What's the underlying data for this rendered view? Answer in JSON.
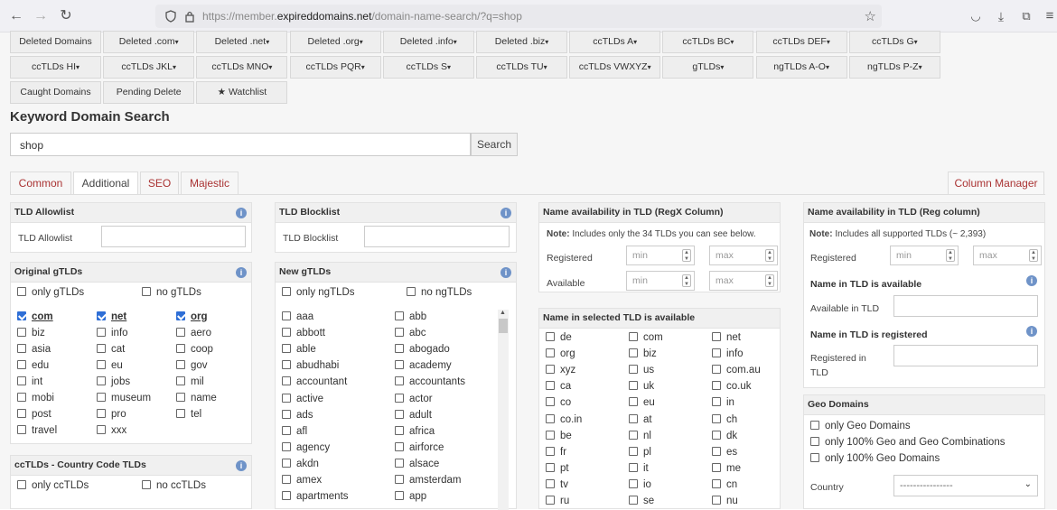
{
  "browser": {
    "url_prefix": "https://member.",
    "url_host": "expireddomains.net",
    "url_path": "/domain-name-search/?q=shop"
  },
  "nav": {
    "row1": [
      "Deleted Domains",
      "Deleted .com",
      "Deleted .net",
      "Deleted .org",
      "Deleted .info",
      "Deleted .biz",
      "ccTLDs A",
      "ccTLDs BC",
      "ccTLDs DEF",
      "ccTLDs G"
    ],
    "row2": [
      "ccTLDs HI",
      "ccTLDs JKL",
      "ccTLDs MNO",
      "ccTLDs PQR",
      "ccTLDs S",
      "ccTLDs TU",
      "ccTLDs VWXYZ",
      "gTLDs",
      "ngTLDs A-O",
      "ngTLDs P-Z"
    ],
    "row3": [
      "Caught Domains",
      "Pending Delete",
      "★ Watchlist"
    ]
  },
  "heading": "Keyword Domain Search",
  "search": {
    "value": "shop",
    "button": "Search"
  },
  "filter_tabs": [
    "Common",
    "Additional",
    "SEO",
    "Majestic"
  ],
  "column_manager": "Column Manager",
  "tld_allowlist": {
    "title": "TLD Allowlist",
    "label": "TLD Allowlist"
  },
  "tld_blocklist": {
    "title": "TLD Blocklist",
    "label": "TLD Blocklist"
  },
  "original_gtlds": {
    "title": "Original gTLDs",
    "only": "only gTLDs",
    "none": "no gTLDs",
    "items": [
      [
        "com",
        "net",
        "org"
      ],
      [
        "biz",
        "info",
        "aero"
      ],
      [
        "asia",
        "cat",
        "coop"
      ],
      [
        "edu",
        "eu",
        "gov"
      ],
      [
        "int",
        "jobs",
        "mil"
      ],
      [
        "mobi",
        "museum",
        "name"
      ],
      [
        "post",
        "pro",
        "tel"
      ],
      [
        "travel",
        "xxx",
        ""
      ]
    ]
  },
  "cctlds": {
    "title": "ccTLDs - Country Code TLDs",
    "only": "only ccTLDs",
    "none": "no ccTLDs"
  },
  "new_gtlds": {
    "title": "New gTLDs",
    "only": "only ngTLDs",
    "none": "no ngTLDs",
    "items": [
      [
        "aaa",
        "abb"
      ],
      [
        "abbott",
        "abc"
      ],
      [
        "able",
        "abogado"
      ],
      [
        "abudhabi",
        "academy"
      ],
      [
        "accountant",
        "accountants"
      ],
      [
        "active",
        "actor"
      ],
      [
        "ads",
        "adult"
      ],
      [
        "afl",
        "africa"
      ],
      [
        "agency",
        "airforce"
      ],
      [
        "akdn",
        "alsace"
      ],
      [
        "amex",
        "amsterdam"
      ],
      [
        "apartments",
        "app"
      ]
    ]
  },
  "name_avail_regx": {
    "title": "Name availability in TLD (RegX Column)",
    "note_bold": "Note:",
    "note": "Includes only the 34 TLDs you can see below.",
    "registered": "Registered",
    "available": "Available",
    "min": "min",
    "max": "max"
  },
  "name_in_selected": {
    "title": "Name in selected TLD is available",
    "items": [
      [
        "de",
        "com",
        "net"
      ],
      [
        "org",
        "biz",
        "info"
      ],
      [
        "xyz",
        "us",
        "com.au"
      ],
      [
        "ca",
        "uk",
        "co.uk"
      ],
      [
        "co",
        "eu",
        "in"
      ],
      [
        "co.in",
        "at",
        "ch"
      ],
      [
        "be",
        "nl",
        "dk"
      ],
      [
        "fr",
        "pl",
        "es"
      ],
      [
        "pt",
        "it",
        "me"
      ],
      [
        "tv",
        "io",
        "cn"
      ],
      [
        "ru",
        "se",
        "nu"
      ]
    ]
  },
  "name_avail_reg": {
    "title": "Name availability in TLD (Reg column)",
    "note_bold": "Note:",
    "note": "Includes all supported TLDs (~ 2,393)",
    "registered": "Registered",
    "min": "min",
    "max": "max",
    "available_head": "Name in TLD is available",
    "available_label": "Available in TLD",
    "registered_head": "Name in TLD is registered",
    "registered_label_1": "Registered in",
    "registered_label_2": "TLD"
  },
  "geo": {
    "title": "Geo Domains",
    "opts": [
      "only Geo Domains",
      "only 100% Geo and Geo Combinations",
      "only 100% Geo Domains"
    ],
    "country_label": "Country",
    "country_value": "----------------"
  },
  "colors": {
    "accent": "#a33333",
    "checkbox": "#2f6fd6",
    "info": "#6f93c8"
  }
}
